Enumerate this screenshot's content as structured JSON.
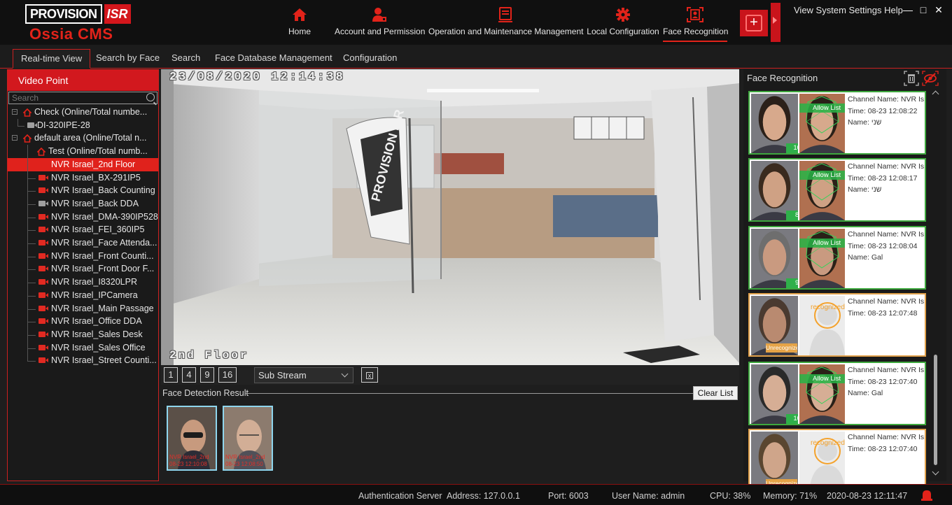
{
  "header": {
    "brand_box": "PROVISION",
    "brand_isr": "ISR",
    "product": "Ossia CMS",
    "nav": [
      {
        "label": "Home",
        "icon": "home-icon"
      },
      {
        "label": "Account and Permission",
        "icon": "user-icon"
      },
      {
        "label": "Operation and Maintenance Management",
        "icon": "document-icon"
      },
      {
        "label": "Local Configuration",
        "icon": "gear-icon"
      },
      {
        "label": "Face Recognition",
        "icon": "face-scan-icon"
      }
    ],
    "add_button": "+",
    "system_menu": "View System Settings Help",
    "window_controls": [
      "—",
      "□",
      "✕"
    ],
    "accent_color": "#d2181e"
  },
  "subtabs": [
    "Real-time View",
    "Search by Face",
    "Search",
    "Face Database Management",
    "Configuration"
  ],
  "left_panel": {
    "title": "Video Point",
    "search_placeholder": "Search",
    "tree": [
      {
        "label": "Check (Online/Total numbe...",
        "type": "area",
        "level": 0
      },
      {
        "label": "DI-320IPE-28",
        "type": "camera",
        "status": "offline",
        "level": 1
      },
      {
        "label": "default area (Online/Total n...",
        "type": "area",
        "level": 0
      },
      {
        "label": "Test (Online/Total numb...",
        "type": "area",
        "level": 1
      },
      {
        "label": "NVR Israel_2nd Floor",
        "type": "camera",
        "status": "selected",
        "level": 1
      },
      {
        "label": "NVR Israel_BX-291IP5",
        "type": "camera",
        "status": "online",
        "level": 1
      },
      {
        "label": "NVR Israel_Back Counting",
        "type": "camera",
        "status": "online",
        "level": 1
      },
      {
        "label": "NVR Israel_Back DDA",
        "type": "camera",
        "status": "offline",
        "level": 1
      },
      {
        "label": "NVR Israel_DMA-390IP528",
        "type": "camera",
        "status": "online",
        "level": 1
      },
      {
        "label": "NVR Israel_FEI_360IP5",
        "type": "camera",
        "status": "online",
        "level": 1
      },
      {
        "label": "NVR Israel_Face Attenda...",
        "type": "camera",
        "status": "online",
        "level": 1
      },
      {
        "label": "NVR Israel_Front Counti...",
        "type": "camera",
        "status": "online",
        "level": 1
      },
      {
        "label": "NVR Israel_Front Door F...",
        "type": "camera",
        "status": "online",
        "level": 1
      },
      {
        "label": "NVR Israel_I8320LPR",
        "type": "camera",
        "status": "online",
        "level": 1
      },
      {
        "label": "NVR Israel_IPCamera",
        "type": "camera",
        "status": "online",
        "level": 1
      },
      {
        "label": "NVR Israel_Main Passage",
        "type": "camera",
        "status": "online",
        "level": 1
      },
      {
        "label": "NVR Israel_Office DDA",
        "type": "camera",
        "status": "online",
        "level": 1
      },
      {
        "label": "NVR Israel_Sales Desk",
        "type": "camera",
        "status": "online",
        "level": 1
      },
      {
        "label": "NVR Israel_Sales Office",
        "type": "camera",
        "status": "online",
        "level": 1
      },
      {
        "label": "NVR Israel_Street Counti...",
        "type": "camera",
        "status": "online",
        "level": 1
      }
    ]
  },
  "video": {
    "osd_time": "23/08/2020  12:14:38",
    "osd_name": "2nd  Floor",
    "flag_text": "PROVISION ISR"
  },
  "layout_controls": {
    "buttons": [
      "1",
      "4",
      "9",
      "16"
    ],
    "stream": "Sub Stream",
    "close_symbol": "x"
  },
  "face_detection": {
    "title": "Face Detection Result",
    "clear_label": "Clear List",
    "thumbs": [
      {
        "caption1": "NVR Israel_2nd",
        "caption2": "08-23 12:10:08"
      },
      {
        "caption1": "NVR Israel_2nd",
        "caption2": "08-23 12:08:50"
      }
    ]
  },
  "face_recognition": {
    "title": "Face Recognition",
    "cards": [
      {
        "type": "allow",
        "tag": "Allow List",
        "channel": "Channel Name: NVR Is",
        "time": "Time: 08-23 12:08:22",
        "name": "Name: שני",
        "similarity": "100%"
      },
      {
        "type": "allow",
        "tag": "Allow List",
        "channel": "Channel Name: NVR Is",
        "time": "Time: 08-23 12:08:17",
        "name": "Name: שני",
        "similarity": "85%"
      },
      {
        "type": "allow",
        "tag": "Allow List",
        "channel": "Channel Name: NVR Is",
        "time": "Time: 08-23 12:08:04",
        "name": "Name: Gal",
        "similarity": "95%"
      },
      {
        "type": "stranger",
        "tag": "recognized",
        "snap_tag": "Unrecognized",
        "channel": "Channel Name: NVR Is",
        "time": "Time: 08-23 12:07:48"
      },
      {
        "type": "allow",
        "tag": "Allow List",
        "channel": "Channel Name: NVR Is",
        "time": "Time: 08-23 12:07:40",
        "name": "Name: Gal",
        "similarity": "100%"
      },
      {
        "type": "stranger",
        "tag": "recognized",
        "snap_tag": "Unrecognized",
        "channel": "Channel Name: NVR Is",
        "time": "Time: 08-23 12:07:40"
      }
    ]
  },
  "status_bar": {
    "auth_server": "Authentication Server",
    "address": "Address: 127.0.0.1",
    "port": "Port: 6003",
    "user": "User Name: admin",
    "cpu": "CPU: 38%",
    "memory": "Memory: 71%",
    "datetime": "2020-08-23 12:11:47",
    "alarm_icon": "alarm-icon"
  }
}
